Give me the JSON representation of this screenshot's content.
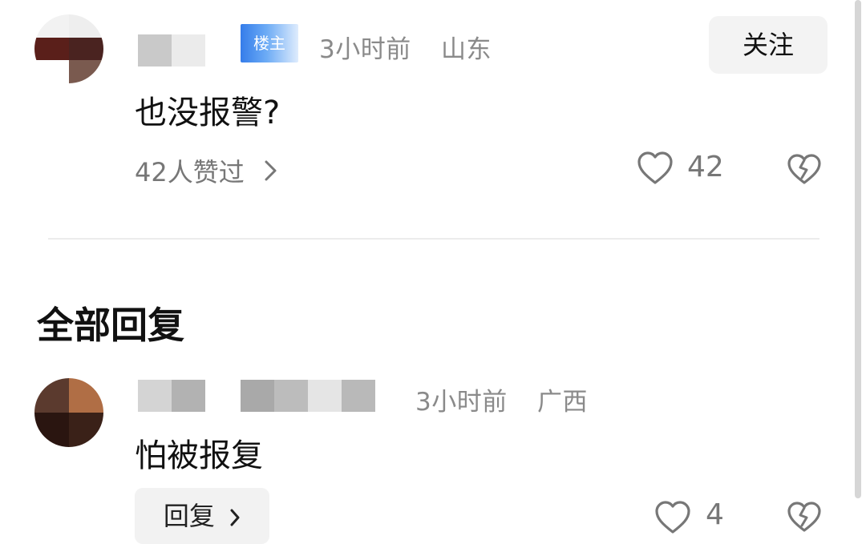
{
  "comment": {
    "badge_label": "楼主",
    "time": "3小时前",
    "location": "山东",
    "follow_label": "关注",
    "text": "也没报警?",
    "liked_by": "42人赞过",
    "like_count": "42"
  },
  "section_title": "全部回复",
  "reply": {
    "time": "3小时前",
    "location": "广西",
    "text": "怕被报复",
    "reply_label": "回复",
    "like_count": "4"
  },
  "icons": {
    "like": "heart-outline-icon",
    "dislike": "broken-heart-icon",
    "chevron": "chevron-right-icon"
  },
  "colors": {
    "badge_blue": "#1f6fe8",
    "meta_gray": "#8a8a8a",
    "text_dark": "#111111"
  }
}
